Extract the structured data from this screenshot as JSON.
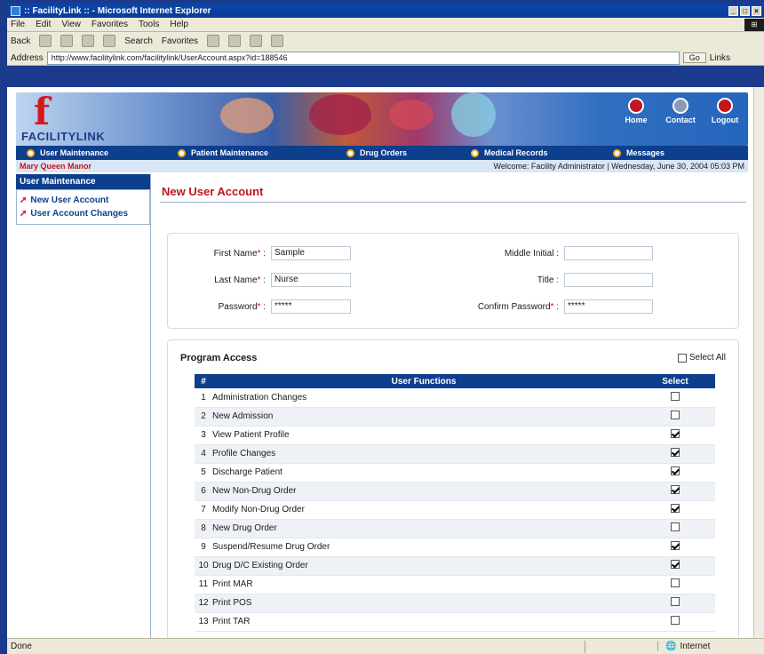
{
  "window": {
    "title": ":: FacilityLink :: - Microsoft Internet Explorer"
  },
  "menubar": [
    "File",
    "Edit",
    "View",
    "Favorites",
    "Tools",
    "Help"
  ],
  "toolbar": {
    "back": "Back",
    "search": "Search",
    "favorites": "Favorites"
  },
  "address": {
    "label": "Address",
    "url": "http://www.facilitylink.com/facilitylink/UserAccount.aspx?id=188546",
    "go": "Go",
    "links": "Links"
  },
  "banner": {
    "logo_letter": "f",
    "logo_text": "FACILITYLINK"
  },
  "topnav": [
    {
      "label": "Home",
      "icon": "home-icon"
    },
    {
      "label": "Contact",
      "icon": "contact-icon"
    },
    {
      "label": "Logout",
      "icon": "logout-icon"
    }
  ],
  "nav": [
    "User Maintenance",
    "Patient Maintenance",
    "Drug Orders",
    "Medical Records",
    "Messages"
  ],
  "infobar": {
    "facility": "Mary Queen Manor",
    "welcome": "Welcome: Facility Administrator | Wednesday, June 30, 2004 05:03 PM"
  },
  "sidebar": {
    "heading": "User Maintenance",
    "links": [
      "New User Account",
      "User Account Changes"
    ]
  },
  "form": {
    "title": "New User Account",
    "first_name_label": "First Name",
    "first_name_value": "Sample",
    "last_name_label": "Last Name",
    "last_name_value": "Nurse",
    "password_label": "Password",
    "password_value": "*****",
    "middle_initial_label": "Middle Initial",
    "middle_initial_value": "",
    "title_label": "Title",
    "title_value": "",
    "confirm_password_label": "Confirm Password",
    "confirm_password_value": "*****",
    "required_mark": "*",
    "colon": ":"
  },
  "access": {
    "title": "Program Access",
    "select_all_label": "Select All",
    "col_num": "#",
    "col_function": "User Functions",
    "col_select": "Select",
    "rows": [
      {
        "num": "1",
        "function": "Administration Changes",
        "selected": false
      },
      {
        "num": "2",
        "function": "New Admission",
        "selected": false
      },
      {
        "num": "3",
        "function": "View Patient Profile",
        "selected": true
      },
      {
        "num": "4",
        "function": "Profile Changes",
        "selected": true
      },
      {
        "num": "5",
        "function": "Discharge Patient",
        "selected": true
      },
      {
        "num": "6",
        "function": "New Non-Drug Order",
        "selected": true
      },
      {
        "num": "7",
        "function": "Modify Non-Drug Order",
        "selected": true
      },
      {
        "num": "8",
        "function": "New Drug Order",
        "selected": false
      },
      {
        "num": "9",
        "function": "Suspend/Resume Drug Order",
        "selected": true
      },
      {
        "num": "10",
        "function": "Drug D/C Existing Order",
        "selected": true
      },
      {
        "num": "11",
        "function": "Print MAR",
        "selected": false
      },
      {
        "num": "12",
        "function": "Print POS",
        "selected": false
      },
      {
        "num": "13",
        "function": "Print TAR",
        "selected": false
      }
    ]
  },
  "status": {
    "left": "Done",
    "zone": "Internet"
  }
}
